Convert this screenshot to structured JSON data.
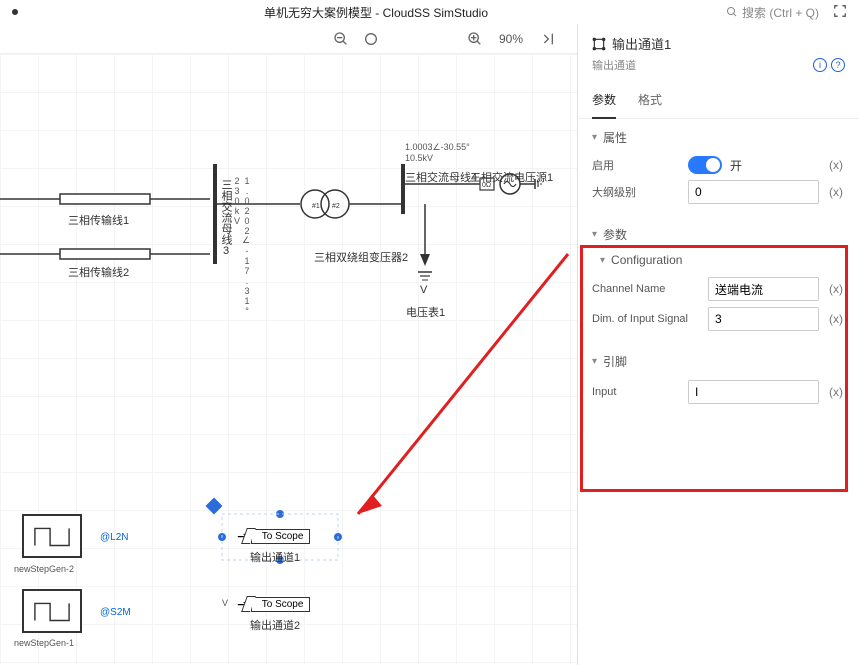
{
  "app": {
    "title": "单机无穷大案例模型 - CloudSS SimStudio",
    "search_placeholder": "搜索 (Ctrl + Q)"
  },
  "toolbar": {
    "zoom": "90%"
  },
  "circuit": {
    "tx_line1": "三相传输线1",
    "tx_line2": "三相传输线2",
    "bus3": "三相交流母线3",
    "bus3_meas": "1.0202∠-17.31°\n230kV",
    "bus4": "三相交流母线4",
    "bus4_meas": "1.0003∠-30.55°\n10.5kV",
    "xfmr": "三相双绕组变压器2",
    "source": "三相交流电压源1",
    "vmeter": "电压表1",
    "v_sym": "V",
    "scope_tag": "To Scope",
    "out1": "输出通道1",
    "out2": "输出通道2",
    "step1_name": "newStepGen-2",
    "step1_port": "@L2N",
    "step2_name": "newStepGen-1",
    "step2_port": "@S2M"
  },
  "panel": {
    "title": "输出通道1",
    "subtitle": "输出通道",
    "tabs": {
      "params": "参数",
      "format": "格式"
    },
    "attrs": {
      "head": "属性",
      "enable_label": "启用",
      "enable_state": "开",
      "outline_label": "大纲级别",
      "outline_value": "0"
    },
    "params": {
      "head": "参数",
      "config": "Configuration",
      "chname_label": "Channel Name",
      "chname_value": "送端电流",
      "dim_label": "Dim. of Input Signal",
      "dim_value": "3"
    },
    "pins": {
      "head": "引脚",
      "input_label": "Input",
      "input_value": "I"
    },
    "x": "(x)"
  }
}
